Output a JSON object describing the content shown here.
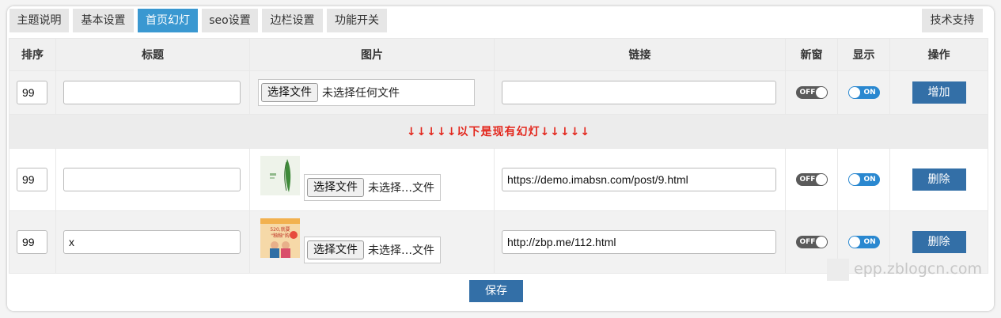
{
  "tabs": [
    {
      "label": "主题说明",
      "active": false
    },
    {
      "label": "基本设置",
      "active": false
    },
    {
      "label": "首页幻灯",
      "active": true
    },
    {
      "label": "seo设置",
      "active": false
    },
    {
      "label": "边栏设置",
      "active": false
    },
    {
      "label": "功能开关",
      "active": false
    }
  ],
  "support_tab": "技术支持",
  "columns": [
    "排序",
    "标题",
    "图片",
    "链接",
    "新窗",
    "显示",
    "操作"
  ],
  "add_row": {
    "order": "99",
    "title": "",
    "file_button": "选择文件",
    "file_label": "未选择任何文件",
    "link": "",
    "new_window": "OFF",
    "display": "ON",
    "action": "增加"
  },
  "divider_text": "↓↓↓↓↓以下是现有幻灯↓↓↓↓↓",
  "slides": [
    {
      "order": "99",
      "title": "",
      "file_button": "选择文件",
      "file_label": "未选择…文件",
      "link": "https://demo.imabsn.com/post/9.html",
      "new_window": "OFF",
      "display": "ON",
      "action": "删除"
    },
    {
      "order": "99",
      "title": "x",
      "file_button": "选择文件",
      "file_label": "未选择…文件",
      "link": "http://zbp.me/112.html",
      "new_window": "OFF",
      "display": "ON",
      "action": "删除",
      "thumb_text": "520,就要",
      "thumb_text2": "\"釉釉\"购"
    }
  ],
  "save_label": "保存",
  "watermark": "epp.zblogcn.com",
  "colors": {
    "tab_active": "#3a98d1",
    "button_blue": "#336fa7",
    "divider_red": "#e3261c",
    "toggle_on": "#2a88d0",
    "toggle_off": "#5a5a5a"
  }
}
